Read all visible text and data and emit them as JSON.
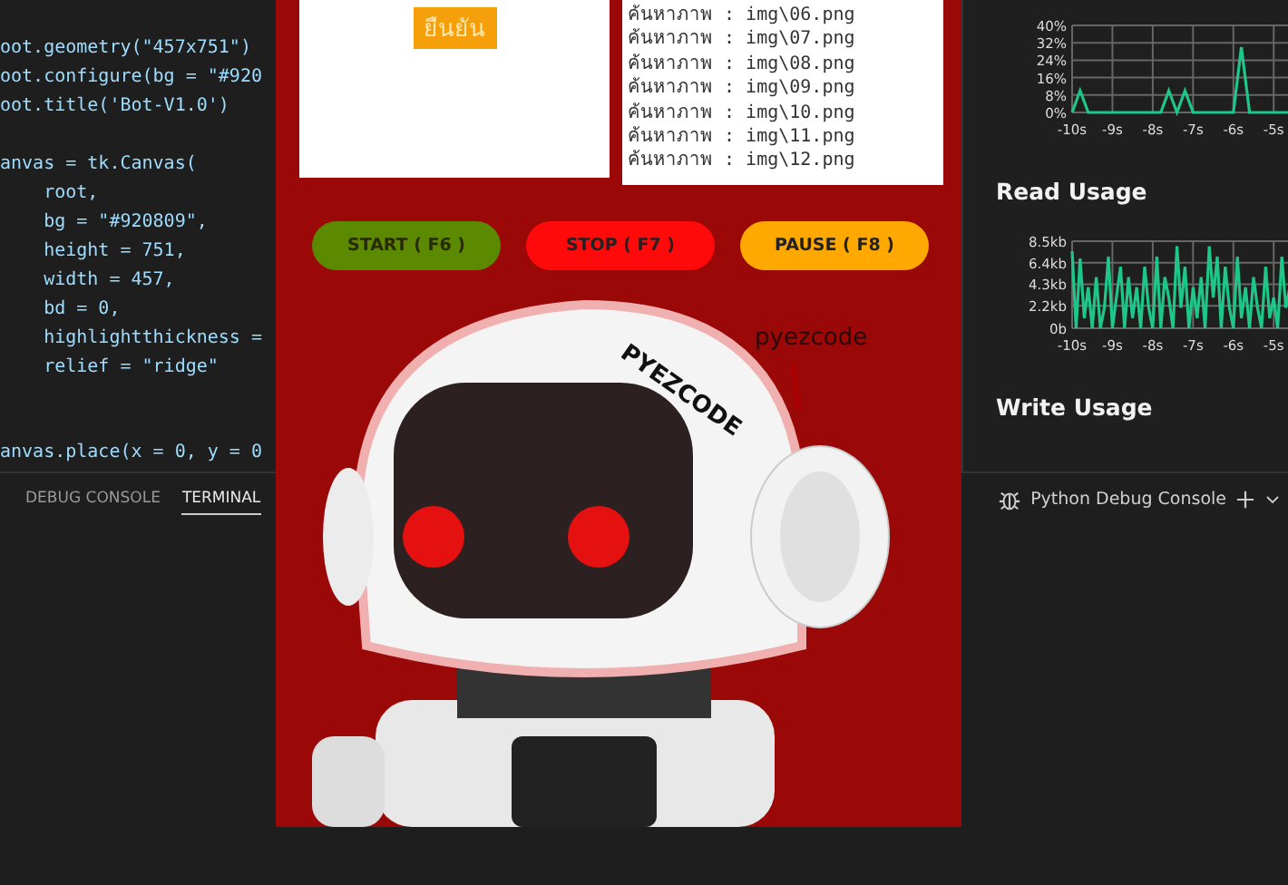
{
  "editor": {
    "blocks": [
      [
        "oot.geometry(\"457x751\")",
        "oot.configure(bg = \"#920",
        "oot.title('Bot-V1.0')"
      ],
      [
        "anvas = tk.Canvas(",
        "    root,",
        "    bg = \"#920809\",",
        "    height = 751,",
        "    width = 457,",
        "    bd = 0,",
        "    highlightthickness =",
        "    relief = \"ridge\""
      ],
      [
        "anvas.place(x = 0, y = 0"
      ]
    ]
  },
  "bot_window": {
    "confirm_button": "ยืนยัน",
    "log": [
      "ค้นหาภาพ : img\\06.png",
      "ค้นหาภาพ : img\\07.png",
      "ค้นหาภาพ : img\\08.png",
      "ค้นหาภาพ : img\\09.png",
      "ค้นหาภาพ : img\\10.png",
      "ค้นหาภาพ : img\\11.png",
      "ค้นหาภาพ : img\\12.png"
    ],
    "buttons": [
      {
        "label": "START ( F6 )",
        "kind": "start"
      },
      {
        "label": "STOP ( F7 )",
        "kind": "stop"
      },
      {
        "label": "PAUSE ( F8 )",
        "kind": "pause"
      }
    ],
    "robot": {
      "helmet_text": "PYEZCODE",
      "caption": "pyezcode"
    }
  },
  "monitor": {
    "panels": [
      {
        "chart_data": {
          "type": "line",
          "grid": true,
          "xlim": [
            -10,
            -4.6
          ],
          "ylim": [
            0,
            40
          ],
          "x": [
            -10,
            -9.8,
            -9.6,
            -9.4,
            -9.2,
            -9,
            -8.8,
            -8.6,
            -8.4,
            -8.2,
            -8,
            -7.8,
            -7.6,
            -7.4,
            -7.2,
            -7,
            -6.8,
            -6.6,
            -6.4,
            -6.2,
            -6,
            -5.8,
            -5.6,
            -5.4,
            -5.2,
            -5,
            -4.8,
            -4.6
          ],
          "xticks": [
            {
              "value": -10,
              "label": "-10s"
            },
            {
              "value": -9,
              "label": "-9s"
            },
            {
              "value": -8,
              "label": "-8s"
            },
            {
              "value": -7,
              "label": "-7s"
            },
            {
              "value": -6,
              "label": "-6s"
            },
            {
              "value": -5,
              "label": "-5s"
            }
          ],
          "yticks": [
            {
              "value": 0,
              "label": "0%"
            },
            {
              "value": 8,
              "label": "8%"
            },
            {
              "value": 16,
              "label": "16%"
            },
            {
              "value": 24,
              "label": "24%"
            },
            {
              "value": 32,
              "label": "32%"
            },
            {
              "value": 40,
              "label": "40%"
            }
          ],
          "series": [
            {
              "color": "#1fc68a",
              "values": [
                0,
                10,
                0,
                0,
                0,
                0,
                0,
                0,
                0,
                0,
                0,
                0,
                10,
                0,
                10,
                0,
                0,
                0,
                0,
                0,
                0,
                30,
                0,
                0,
                0,
                0,
                0,
                0
              ]
            }
          ]
        }
      },
      {
        "title": "Read Usage",
        "chart_data": {
          "type": "line",
          "grid": true,
          "xlim": [
            -10,
            -4.6
          ],
          "ylim": [
            0,
            8.5
          ],
          "x": [
            -10,
            -9.9,
            -9.8,
            -9.7,
            -9.6,
            -9.5,
            -9.4,
            -9.3,
            -9.2,
            -9.1,
            -9,
            -8.9,
            -8.8,
            -8.7,
            -8.6,
            -8.5,
            -8.4,
            -8.3,
            -8.2,
            -8.1,
            -8,
            -7.9,
            -7.8,
            -7.7,
            -7.6,
            -7.5,
            -7.4,
            -7.3,
            -7.2,
            -7.1,
            -7,
            -6.9,
            -6.8,
            -6.7,
            -6.6,
            -6.5,
            -6.4,
            -6.3,
            -6.2,
            -6.1,
            -6,
            -5.9,
            -5.8,
            -5.7,
            -5.6,
            -5.5,
            -5.4,
            -5.3,
            -5.2,
            -5.1,
            -5,
            -4.9,
            -4.8,
            -4.7,
            -4.6
          ],
          "xticks": [
            {
              "value": -10,
              "label": "-10s"
            },
            {
              "value": -9,
              "label": "-9s"
            },
            {
              "value": -8,
              "label": "-8s"
            },
            {
              "value": -7,
              "label": "-7s"
            },
            {
              "value": -6,
              "label": "-6s"
            },
            {
              "value": -5,
              "label": "-5s"
            }
          ],
          "yticks": [
            {
              "value": 0,
              "label": "0b"
            },
            {
              "value": 2.2,
              "label": "2.2kb"
            },
            {
              "value": 4.3,
              "label": "4.3kb"
            },
            {
              "value": 6.4,
              "label": "6.4kb"
            },
            {
              "value": 8.5,
              "label": "8.5kb"
            }
          ],
          "series": [
            {
              "color": "#1fc68a",
              "values": [
                7.5,
                0,
                6.8,
                1,
                4,
                0,
                5,
                0,
                2,
                7,
                0,
                3,
                6,
                0,
                5,
                1,
                4,
                0,
                6,
                2,
                0,
                7,
                0,
                5,
                3,
                0,
                8,
                2,
                6,
                0,
                4,
                1,
                5,
                0,
                8,
                3,
                7,
                0,
                6,
                2,
                0,
                7,
                1,
                4,
                0,
                5,
                2,
                0,
                6,
                1,
                3,
                0,
                7,
                2,
                4
              ]
            }
          ]
        }
      },
      {
        "title": "Write Usage"
      }
    ]
  },
  "panel_tabs": [
    {
      "label": "DEBUG CONSOLE",
      "selected": false
    },
    {
      "label": "TERMINAL",
      "selected": true
    }
  ],
  "terminal_name": "Python Debug Console"
}
